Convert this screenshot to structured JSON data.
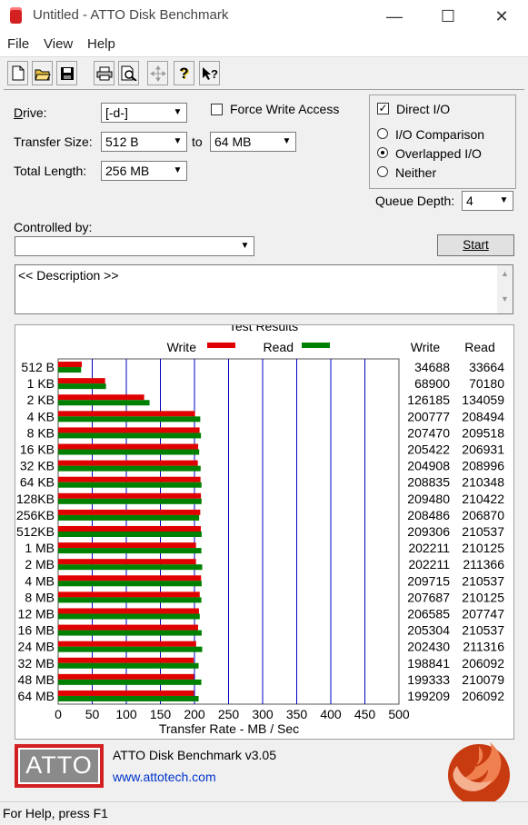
{
  "window": {
    "title": "Untitled - ATTO Disk Benchmark",
    "minimize": "—",
    "maximize": "☐",
    "close": "✕"
  },
  "menu": {
    "file": "File",
    "view": "View",
    "help": "Help"
  },
  "form": {
    "drive_label": "Drive:",
    "drive_value": "[-d-]",
    "force_write_label": "Force Write Access",
    "direct_io_label": "Direct I/O",
    "transfer_size_label": "Transfer Size:",
    "transfer_from": "512 B",
    "to_label": "to",
    "transfer_to": "64 MB",
    "total_length_label": "Total Length:",
    "total_length_value": "256 MB",
    "io_comparison_label": "I/O Comparison",
    "overlapped_io_label": "Overlapped I/O",
    "neither_label": "Neither",
    "queue_depth_label": "Queue Depth:",
    "queue_depth_value": "4",
    "controlled_by_label": "Controlled by:",
    "controlled_by_value": "",
    "start_label": "Start",
    "description_text": "<< Description >>"
  },
  "results": {
    "title": "Test Results",
    "legend_write": "Write",
    "legend_read": "Read",
    "col_write": "Write",
    "col_read": "Read",
    "x_axis_label": "Transfer Rate - MB / Sec"
  },
  "chart_data": {
    "type": "bar",
    "orientation": "horizontal",
    "title": "Test Results",
    "xlabel": "Transfer Rate - MB / Sec",
    "xlim": [
      0,
      500
    ],
    "xticks": [
      "0",
      "50",
      "100",
      "150",
      "200",
      "250",
      "300",
      "350",
      "400",
      "450",
      "500"
    ],
    "categories": [
      "512 B",
      "1 KB",
      "2 KB",
      "4 KB",
      "8 KB",
      "16 KB",
      "32 KB",
      "64 KB",
      "128KB",
      "256KB",
      "512KB",
      "1 MB",
      "2 MB",
      "4 MB",
      "8 MB",
      "12 MB",
      "16 MB",
      "24 MB",
      "32 MB",
      "48 MB",
      "64 MB"
    ],
    "series": [
      {
        "name": "Write",
        "color": "#e00000",
        "values": [
          34688,
          68900,
          126185,
          200777,
          207470,
          205422,
          204908,
          208835,
          209480,
          208486,
          209306,
          202211,
          202211,
          209715,
          207687,
          206585,
          205304,
          202430,
          198841,
          199333,
          199209
        ]
      },
      {
        "name": "Read",
        "color": "#008000",
        "values": [
          33664,
          70180,
          134059,
          208494,
          209518,
          206931,
          208996,
          210348,
          210422,
          206870,
          210537,
          210125,
          211366,
          210537,
          210125,
          207747,
          210537,
          211316,
          206092,
          210079,
          206092
        ]
      }
    ],
    "value_units_note": "KB/s",
    "write_labels": [
      "34688",
      "68900",
      "126185",
      "200777",
      "207470",
      "205422",
      "204908",
      "208835",
      "209480",
      "208486",
      "209306",
      "202211",
      "202211",
      "209715",
      "207687",
      "206585",
      "205304",
      "202430",
      "198841",
      "199333",
      "199209"
    ],
    "read_labels": [
      "33664",
      "70180",
      "134059",
      "208494",
      "209518",
      "206931",
      "208996",
      "210348",
      "210422",
      "206870",
      "210537",
      "210125",
      "211366",
      "210537",
      "210125",
      "207747",
      "210537",
      "211316",
      "206092",
      "210079",
      "206092"
    ]
  },
  "footer": {
    "logo_text": "ATTO",
    "product": "ATTO Disk Benchmark v3.05",
    "url": "www.attotech.com"
  },
  "status": {
    "text": "For Help, press F1"
  },
  "colors": {
    "grid_line": "#0000c0",
    "write": "#e00000",
    "read": "#008000",
    "logo_red": "#d22020"
  }
}
